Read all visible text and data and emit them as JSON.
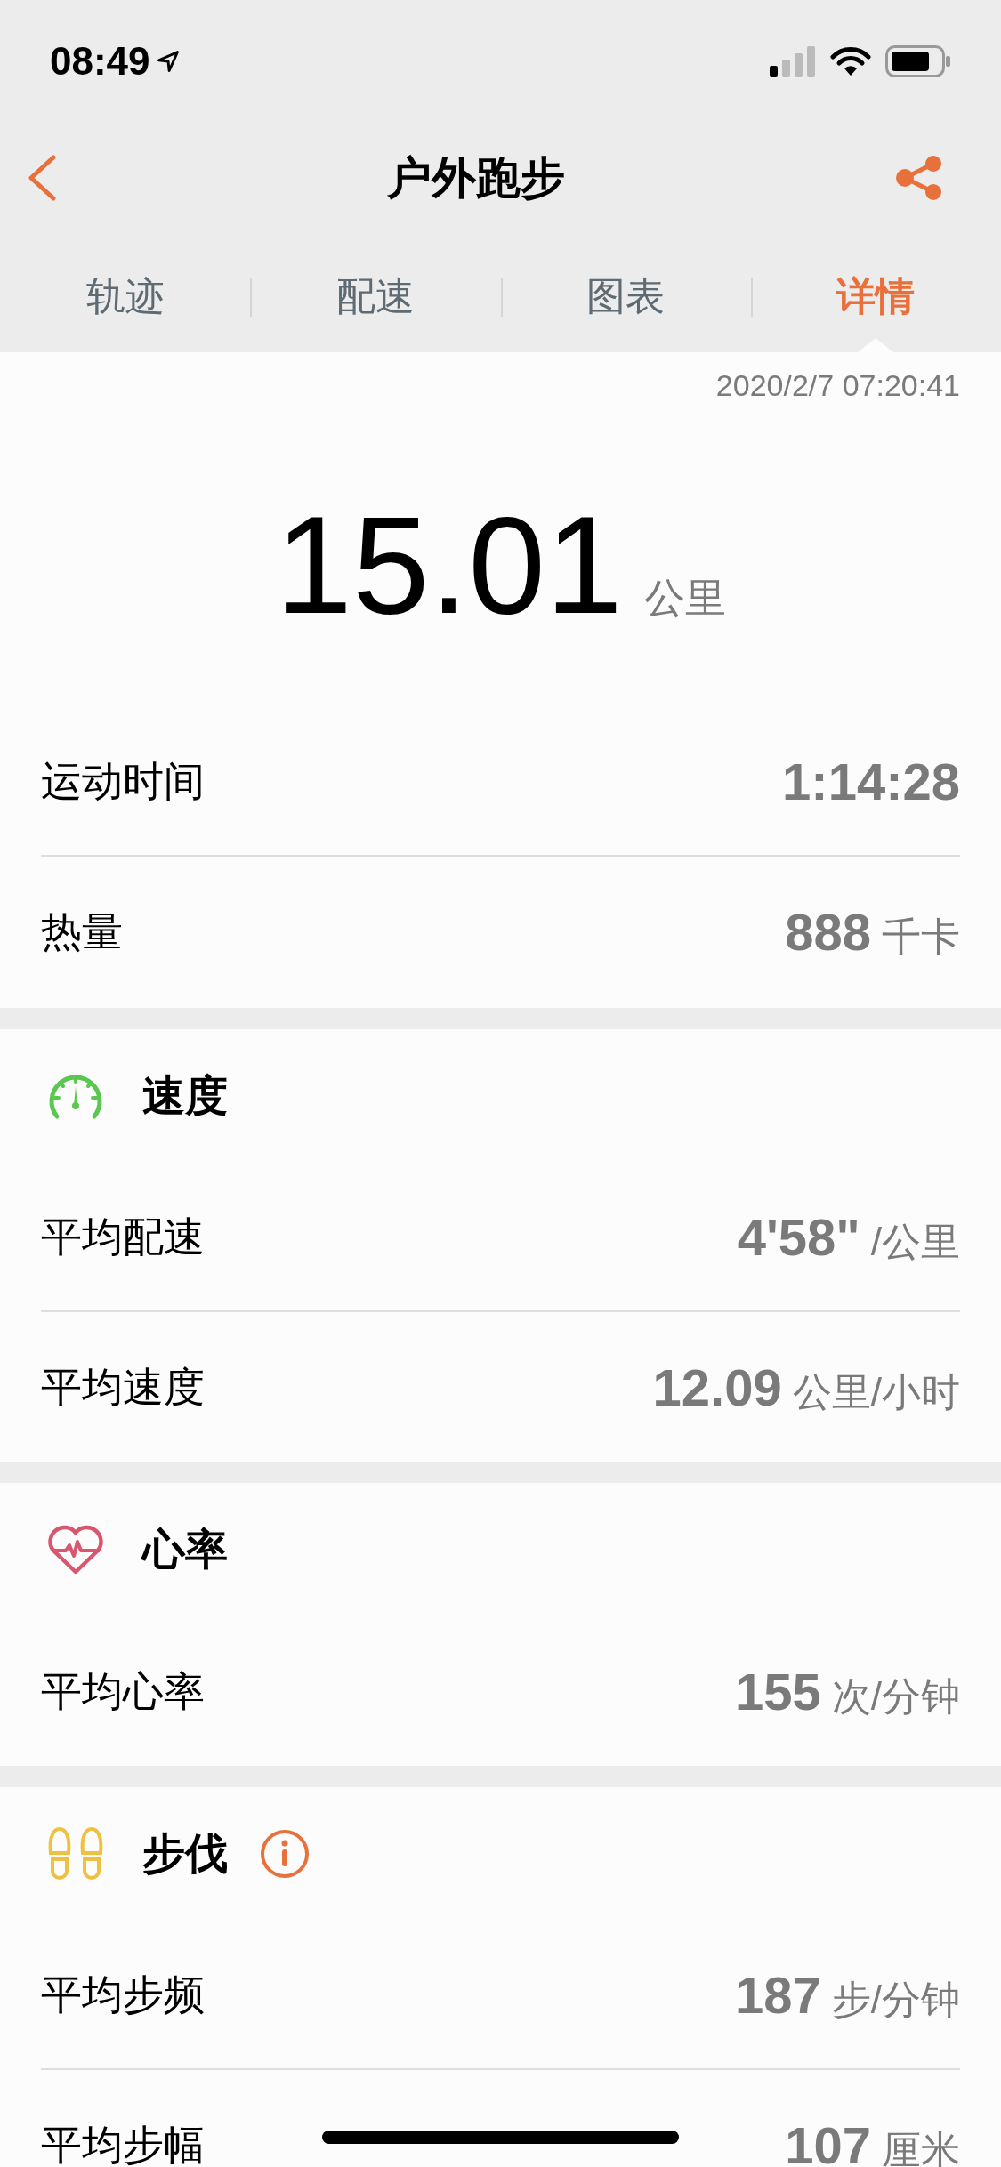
{
  "status_bar": {
    "time": "08:49"
  },
  "nav": {
    "title": "户外跑步"
  },
  "tabs": [
    {
      "label": "轨迹",
      "selected": false
    },
    {
      "label": "配速",
      "selected": false
    },
    {
      "label": "图表",
      "selected": false
    },
    {
      "label": "详情",
      "selected": true
    }
  ],
  "summary": {
    "date": "2020/2/7 07:20:41",
    "distance": "15.01",
    "distance_unit": "公里",
    "rows": [
      {
        "label": "运动时间",
        "value": "1:14:28"
      },
      {
        "label": "热量",
        "value": "888",
        "unit": "千卡"
      }
    ]
  },
  "sections": [
    {
      "kind": "speed",
      "title": "速度",
      "info": false,
      "rows": [
        {
          "label": "平均配速",
          "value": "4'58\"",
          "unit": "/公里"
        },
        {
          "label": "平均速度",
          "value": "12.09",
          "unit": "公里/小时"
        }
      ]
    },
    {
      "kind": "heart",
      "title": "心率",
      "info": false,
      "rows": [
        {
          "label": "平均心率",
          "value": "155",
          "unit": "次/分钟"
        }
      ]
    },
    {
      "kind": "steps",
      "title": "步伐",
      "info": true,
      "rows": [
        {
          "label": "平均步频",
          "value": "187",
          "unit": "步/分钟"
        },
        {
          "label": "平均步幅",
          "value": "107",
          "unit": "厘米"
        }
      ]
    }
  ]
}
